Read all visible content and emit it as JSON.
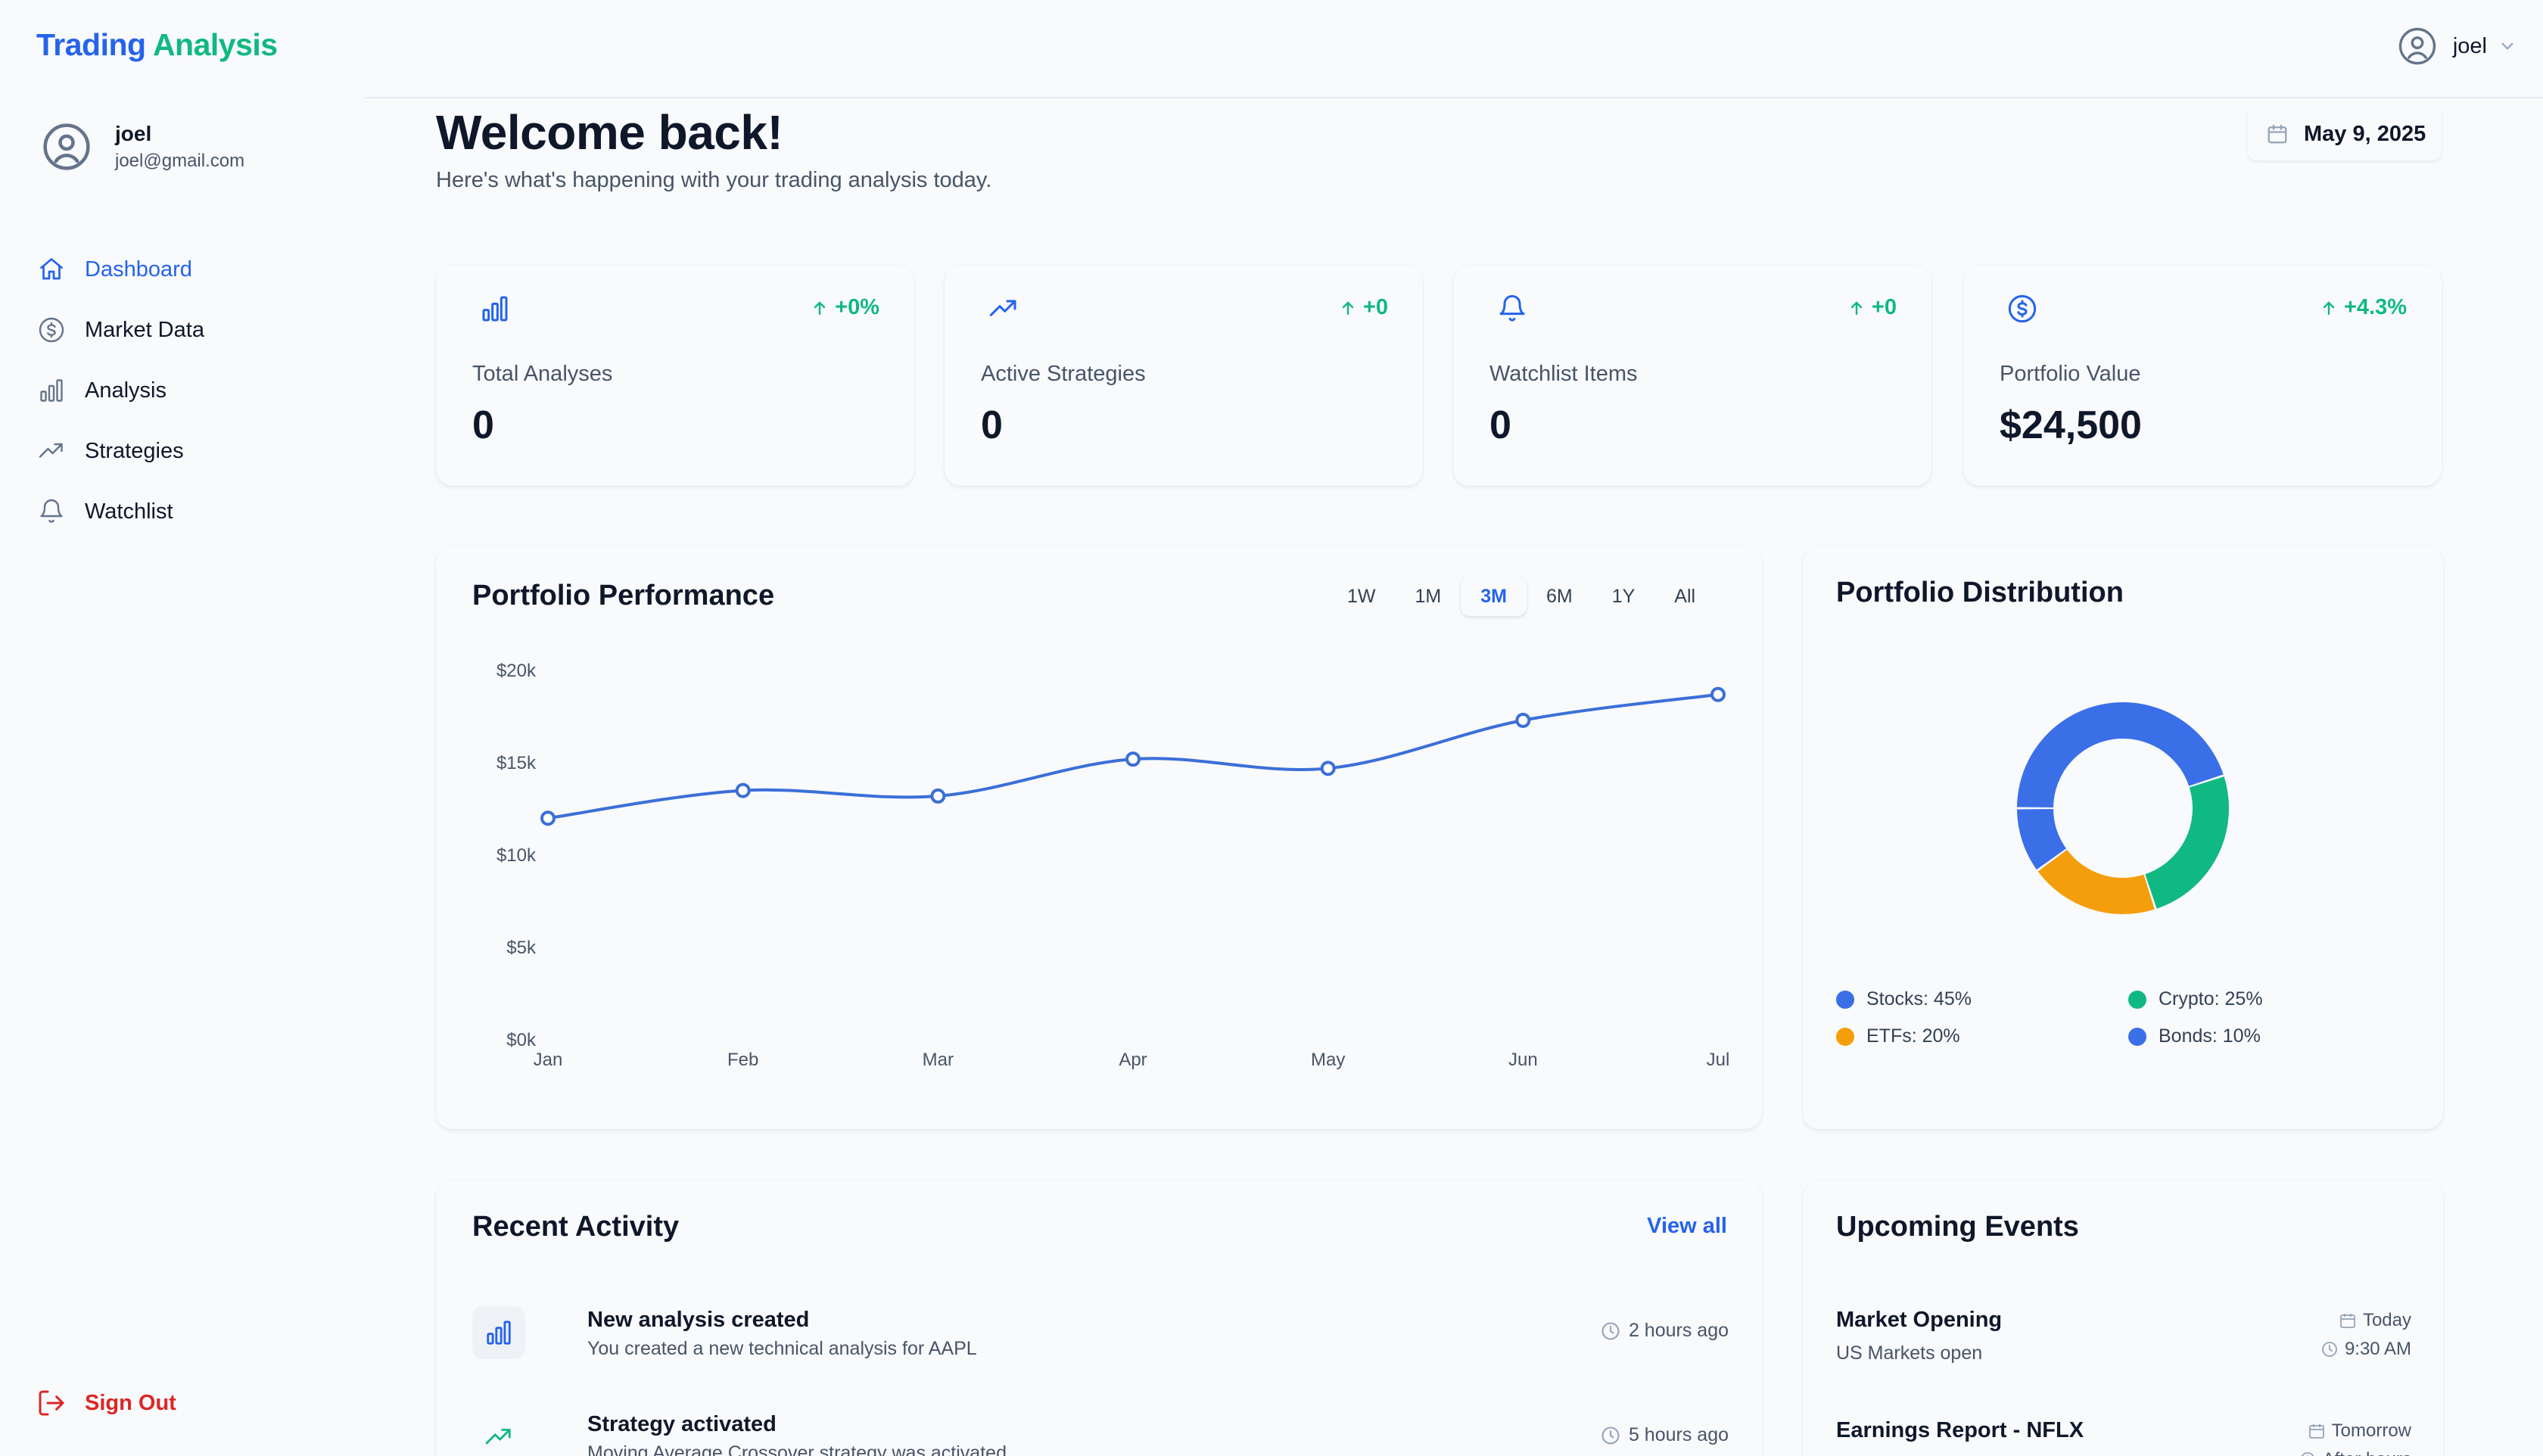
{
  "app": {
    "brand_part1": "Trading",
    "brand_part2": "Analysis",
    "brand_color1": "#2563eb",
    "brand_color2": "#10b981"
  },
  "sidebar": {
    "user_name": "joel",
    "user_email": "joel@gmail.com",
    "items": [
      {
        "label": "Dashboard",
        "icon": "home-icon",
        "active": true
      },
      {
        "label": "Market Data",
        "icon": "dollar-circle-icon",
        "active": false
      },
      {
        "label": "Analysis",
        "icon": "bar-chart-icon",
        "active": false
      },
      {
        "label": "Strategies",
        "icon": "trend-up-icon",
        "active": false
      },
      {
        "label": "Watchlist",
        "icon": "bell-icon",
        "active": false
      }
    ],
    "sign_out": "Sign Out"
  },
  "topbar": {
    "user_label": "joel"
  },
  "header": {
    "title": "Welcome back!",
    "subtitle": "Here's what's happening with your trading analysis today.",
    "date": "May 9, 2025"
  },
  "stats": [
    {
      "label": "Total Analyses",
      "value": "0",
      "delta": "+0%",
      "icon": "bar-chart-icon"
    },
    {
      "label": "Active Strategies",
      "value": "0",
      "delta": "+0",
      "icon": "trend-up-icon"
    },
    {
      "label": "Watchlist Items",
      "value": "0",
      "delta": "+0",
      "icon": "bell-icon"
    },
    {
      "label": "Portfolio Value",
      "value": "$24,500",
      "delta": "+4.3%",
      "icon": "dollar-circle-icon"
    }
  ],
  "performance": {
    "title": "Portfolio Performance",
    "ranges": [
      "1W",
      "1M",
      "3M",
      "6M",
      "1Y",
      "All"
    ],
    "active_range": "3M"
  },
  "distribution": {
    "title": "Portfolio Distribution",
    "legend": [
      "Stocks: 45%",
      "Crypto: 25%",
      "ETFs: 20%",
      "Bonds: 10%"
    ]
  },
  "activity": {
    "title": "Recent Activity",
    "view_all": "View all",
    "items": [
      {
        "title": "New analysis created",
        "desc": "You created a new technical analysis for AAPL",
        "time": "2 hours ago",
        "icon": "bar-chart-icon"
      },
      {
        "title": "Strategy activated",
        "desc": "Moving Average Crossover strategy was activated",
        "time": "5 hours ago",
        "icon": "trend-up-icon"
      }
    ]
  },
  "events": {
    "title": "Upcoming Events",
    "items": [
      {
        "title": "Market Opening",
        "desc": "US Markets open",
        "day": "Today",
        "time": "9:30 AM"
      },
      {
        "title": "Earnings Report - NFLX",
        "desc": "",
        "day": "Tomorrow",
        "time": "After hours"
      }
    ]
  },
  "chart_data": [
    {
      "type": "line",
      "categories": [
        "Jan",
        "Feb",
        "Mar",
        "Apr",
        "May",
        "Jun",
        "Jul"
      ],
      "series": [
        {
          "values": [
            12000,
            13500,
            13200,
            15200,
            14700,
            17300,
            18700
          ],
          "color": "#3b6fd8"
        }
      ],
      "yticks": [
        "$0k",
        "$5k",
        "$10k",
        "$15k",
        "$20k"
      ],
      "ylim": [
        0,
        20000
      ],
      "grid": false
    },
    {
      "type": "pie",
      "donut": true,
      "categories": [
        "Stocks",
        "Crypto",
        "ETFs",
        "Bonds"
      ],
      "values": [
        45,
        25,
        20,
        10
      ],
      "colors": [
        "#3b6fe8",
        "#10b981",
        "#f59e0b",
        "#3b6fe8"
      ]
    }
  ]
}
